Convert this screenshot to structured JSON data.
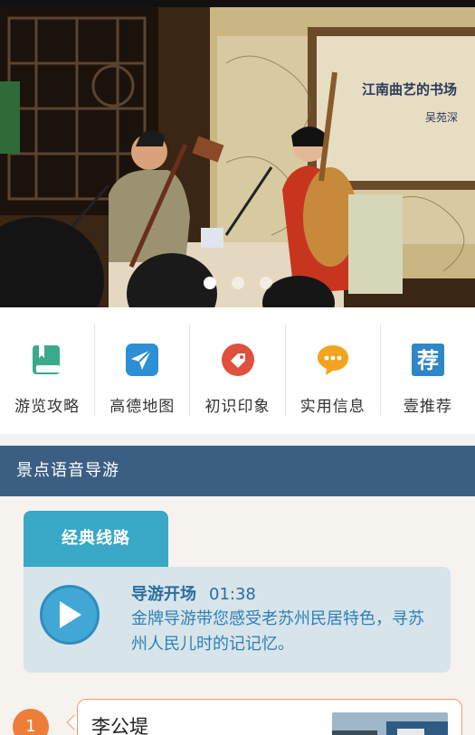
{
  "banner": {
    "sign_text": "江南曲艺的书场",
    "sign_subtext": "吴苑深",
    "slides": 3,
    "active_slide": 1
  },
  "quicknav": [
    {
      "label": "游览攻略",
      "icon": "book-icon",
      "color": "#3aaa8a"
    },
    {
      "label": "高德地图",
      "icon": "map-send-icon",
      "color": "#2d8fd6"
    },
    {
      "label": "初识印象",
      "icon": "tag-icon",
      "color": "#e0503c"
    },
    {
      "label": "实用信息",
      "icon": "chat-bubble-icon",
      "color": "#f2a41f"
    },
    {
      "label": "壹推荐",
      "icon": "recommend-icon",
      "color": "#2f86c9"
    }
  ],
  "section": {
    "title": "景点语音导游"
  },
  "route": {
    "tab_label": "经典线路",
    "audio_title": "导游开场",
    "audio_duration": "01:38",
    "audio_desc": "金牌导游带您感受老苏州民居特色，寻苏州人民儿时的记记忆。"
  },
  "stops": [
    {
      "number": "1",
      "name": "李公堤"
    }
  ],
  "colors": {
    "section_bar": "#3b5f82",
    "accent_blue": "#3aa8c7",
    "stop_orange": "#ee7d3a"
  }
}
